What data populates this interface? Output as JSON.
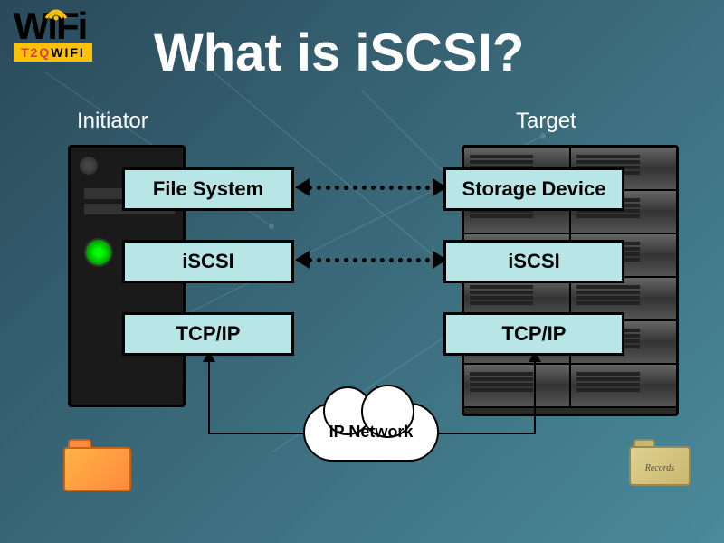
{
  "logo": {
    "main": "WiFi",
    "sub_t2q": "T2Q",
    "sub_wifi": "WIFI"
  },
  "title": "What is iSCSI?",
  "labels": {
    "initiator": "Initiator",
    "target": "Target"
  },
  "left_stack": {
    "layer1": "File System",
    "layer2": "iSCSI",
    "layer3": "TCP/IP"
  },
  "right_stack": {
    "layer1": "Storage Device",
    "layer2": "iSCSI",
    "layer3": "TCP/IP"
  },
  "network": {
    "cloud_label": "IP Network"
  },
  "folder": {
    "records_label": "Records"
  }
}
